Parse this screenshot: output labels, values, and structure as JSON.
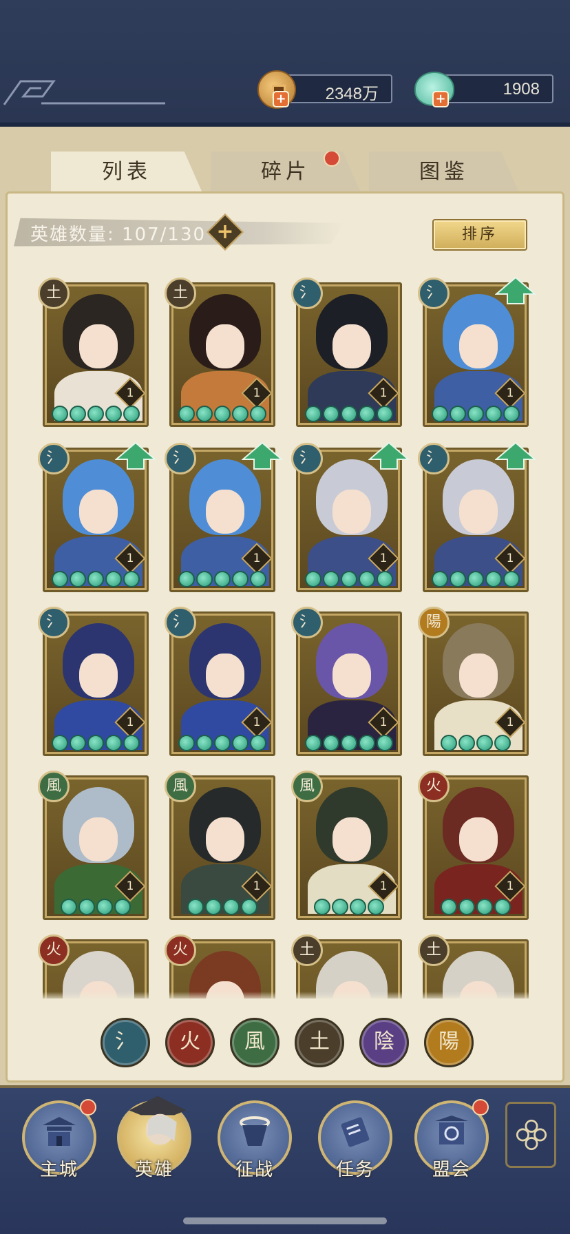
{
  "resources": [
    {
      "name": "copper",
      "value": "2348万"
    },
    {
      "name": "jade",
      "value": "1908"
    }
  ],
  "tabs": [
    {
      "label": "列表",
      "active": true,
      "badge": false
    },
    {
      "label": "碎片",
      "active": false,
      "badge": true
    },
    {
      "label": "图鉴",
      "active": false,
      "badge": false
    }
  ],
  "hero_count": {
    "label": "英雄数量:",
    "value": "107/130",
    "plus": "+"
  },
  "sort_label": "排序",
  "element_glyphs": {
    "water": "氵",
    "fire": "火",
    "wind": "風",
    "earth": "土",
    "yin": "陰",
    "yang": "陽"
  },
  "element_colors": {
    "water": "#2f5e6c",
    "fire": "#8c2f22",
    "wind": "#3e6d43",
    "earth": "#4b3f2c",
    "yin": "#5b3f85",
    "yang": "#b27b1e"
  },
  "heroes": [
    {
      "element": "earth",
      "level": "1",
      "stars": 5,
      "upgrade": false,
      "hair": "#2b2621",
      "outfit": "#e9e2d4"
    },
    {
      "element": "earth",
      "level": "1",
      "stars": 5,
      "upgrade": false,
      "hair": "#2a1d19",
      "outfit": "#c47a3a"
    },
    {
      "element": "water",
      "level": "1",
      "stars": 5,
      "upgrade": false,
      "hair": "#1c1f26",
      "outfit": "#2e3a58"
    },
    {
      "element": "water",
      "level": "1",
      "stars": 5,
      "upgrade": true,
      "hair": "#4f8ed6",
      "outfit": "#3e5fa3"
    },
    {
      "element": "water",
      "level": "1",
      "stars": 5,
      "upgrade": true,
      "hair": "#4f8ed6",
      "outfit": "#3e5fa3"
    },
    {
      "element": "water",
      "level": "1",
      "stars": 5,
      "upgrade": true,
      "hair": "#4f8ed6",
      "outfit": "#3e5fa3"
    },
    {
      "element": "water",
      "level": "1",
      "stars": 5,
      "upgrade": true,
      "hair": "#c8cbd6",
      "outfit": "#3c4f88"
    },
    {
      "element": "water",
      "level": "1",
      "stars": 5,
      "upgrade": true,
      "hair": "#c8cbd6",
      "outfit": "#3c4f88"
    },
    {
      "element": "water",
      "level": "1",
      "stars": 5,
      "upgrade": false,
      "hair": "#2c3570",
      "outfit": "#2f4aa0"
    },
    {
      "element": "water",
      "level": "1",
      "stars": 5,
      "upgrade": false,
      "hair": "#2c3570",
      "outfit": "#2f4aa0"
    },
    {
      "element": "water",
      "level": "1",
      "stars": 5,
      "upgrade": false,
      "hair": "#6a56a8",
      "outfit": "#2b2440"
    },
    {
      "element": "yang",
      "level": "1",
      "stars": 4,
      "upgrade": false,
      "hair": "#8a7a5c",
      "outfit": "#e8e0c6"
    },
    {
      "element": "wind",
      "level": "1",
      "stars": 4,
      "upgrade": false,
      "hair": "#aebcc9",
      "outfit": "#3b6a35"
    },
    {
      "element": "wind",
      "level": "1",
      "stars": 4,
      "upgrade": false,
      "hair": "#262a2a",
      "outfit": "#3a4a40"
    },
    {
      "element": "wind",
      "level": "1",
      "stars": 4,
      "upgrade": false,
      "hair": "#2f3a2c",
      "outfit": "#e2ddc3"
    },
    {
      "element": "fire",
      "level": "1",
      "stars": 4,
      "upgrade": false,
      "hair": "#6b2a22",
      "outfit": "#7a2420"
    },
    {
      "element": "fire",
      "level": "",
      "stars": 0,
      "upgrade": false,
      "hair": "#d9d4cc",
      "outfit": "#2a2a2a"
    },
    {
      "element": "fire",
      "level": "",
      "stars": 0,
      "upgrade": false,
      "hair": "#7a3b22",
      "outfit": "#b02e2a"
    },
    {
      "element": "earth",
      "level": "",
      "stars": 0,
      "upgrade": false,
      "hair": "#d6d1c7",
      "outfit": "#e4ddd0"
    },
    {
      "element": "earth",
      "level": "",
      "stars": 0,
      "upgrade": false,
      "hair": "#d6d1c7",
      "outfit": "#e4ddd0"
    }
  ],
  "filters": [
    "water",
    "fire",
    "wind",
    "earth",
    "yin",
    "yang"
  ],
  "nav": [
    {
      "label": "主城",
      "icon": "palace-icon",
      "active": false,
      "badge": true
    },
    {
      "label": "英雄",
      "icon": "hero-icon",
      "active": true,
      "badge": false
    },
    {
      "label": "征战",
      "icon": "battle-icon",
      "active": false,
      "badge": false
    },
    {
      "label": "任务",
      "icon": "task-scroll-icon",
      "active": false,
      "badge": false
    },
    {
      "label": "盟会",
      "icon": "guild-gate-icon",
      "active": false,
      "badge": true
    }
  ]
}
